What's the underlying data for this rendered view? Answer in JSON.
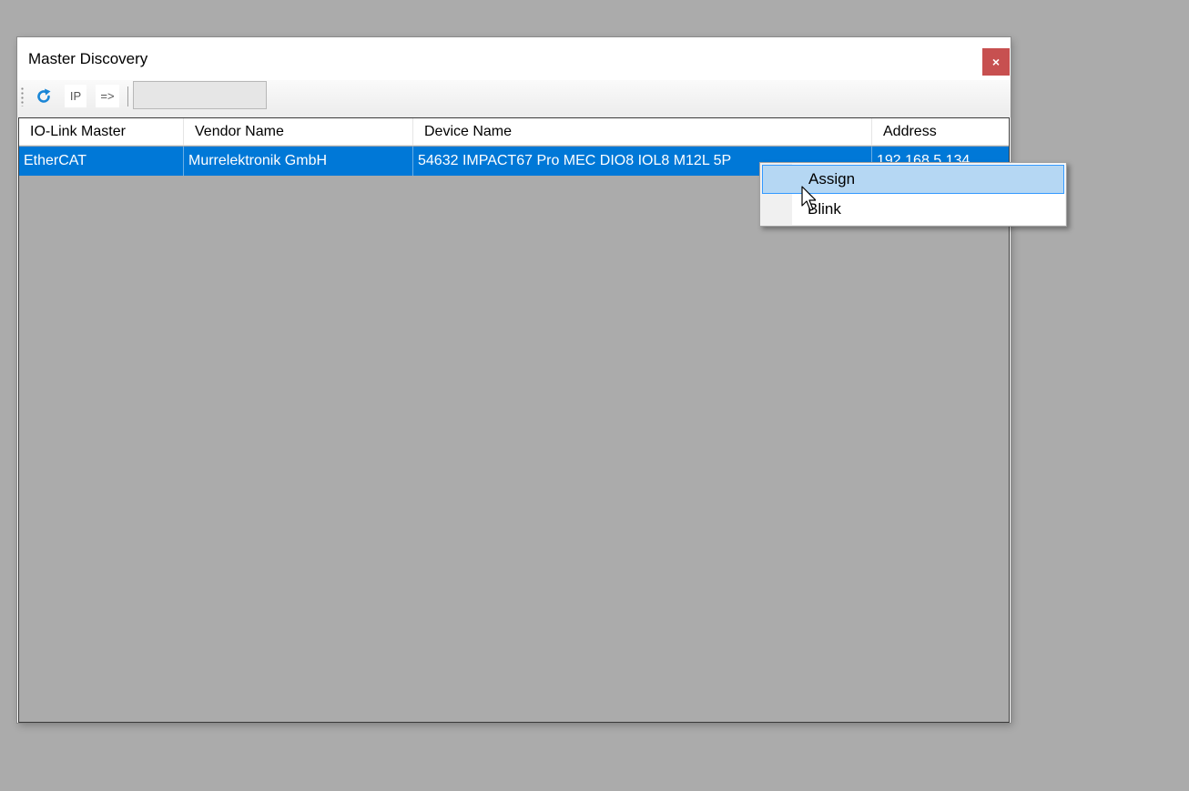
{
  "window": {
    "title": "Master Discovery",
    "close_label": "×"
  },
  "toolbar": {
    "refresh_icon": "refresh-icon",
    "ip_label": "IP",
    "arrow_label": "=>",
    "input_value": ""
  },
  "table": {
    "columns": [
      "IO-Link Master",
      "Vendor Name",
      "Device Name",
      "Address"
    ],
    "rows": [
      {
        "master": "EtherCAT",
        "vendor": "Murrelektronik GmbH",
        "device": "54632 IMPACT67 Pro MEC DIO8 IOL8 M12L 5P",
        "address": "192.168.5.134"
      }
    ],
    "selected_row": 0,
    "selection_color": "#0078d7"
  },
  "context_menu": {
    "items": [
      "Assign",
      "Blink"
    ],
    "highlighted": "Assign"
  },
  "colors": {
    "close_button": "#c75050",
    "desktop": "#ababab",
    "menu_highlight": "#b5d7f3"
  }
}
